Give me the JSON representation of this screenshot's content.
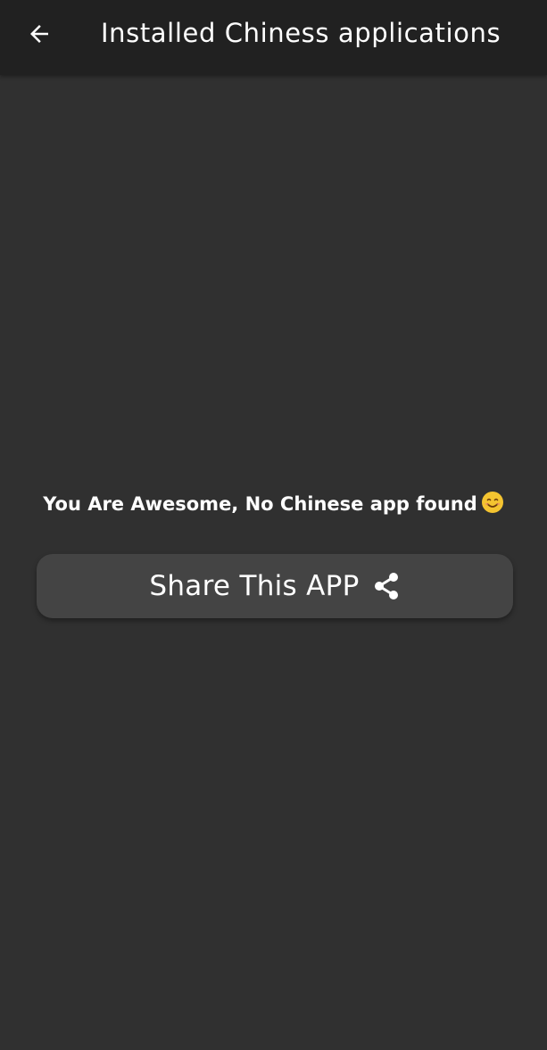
{
  "app_bar": {
    "title": "Installed Chiness applications",
    "back_icon": "arrow-left-icon"
  },
  "main": {
    "message": "You Are Awesome, No Chinese app found",
    "message_emoji_icon": "smiling-face-icon",
    "share_button": {
      "label": "Share This APP",
      "icon": "share-icon"
    }
  },
  "colors": {
    "background": "#303030",
    "app_bar": "#212121",
    "button": "#444444",
    "text": "#ffffff",
    "emoji": "#f4c430"
  }
}
